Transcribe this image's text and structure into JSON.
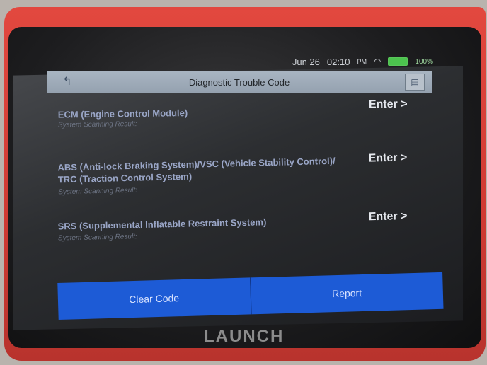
{
  "status": {
    "date": "Jun 26",
    "time": "02:10",
    "ampm": "PM",
    "battery": "100%"
  },
  "header": {
    "title": "Diagnostic Trouble Code",
    "back_icon": "back-arrow-icon",
    "menu_icon": "menu-icon"
  },
  "systems": [
    {
      "title": "ECM (Engine Control Module)",
      "subtitle": "System Scanning Result:",
      "action": "Enter >"
    },
    {
      "title": "ABS (Anti-lock Braking System)/VSC (Vehicle Stability Control)/ TRC (Traction Control System)",
      "subtitle": "System Scanning Result:",
      "action": "Enter >"
    },
    {
      "title": "SRS (Supplemental Inflatable Restraint System)",
      "subtitle": "System Scanning Result:",
      "action": "Enter >"
    }
  ],
  "buttons": {
    "clear_code": "Clear Code",
    "report": "Report"
  },
  "brand": {
    "logo": "LAUNCH"
  },
  "colors": {
    "accent": "#1d5bd6",
    "device_body": "#cf3a33",
    "header_bg": "#a9b5c2"
  }
}
